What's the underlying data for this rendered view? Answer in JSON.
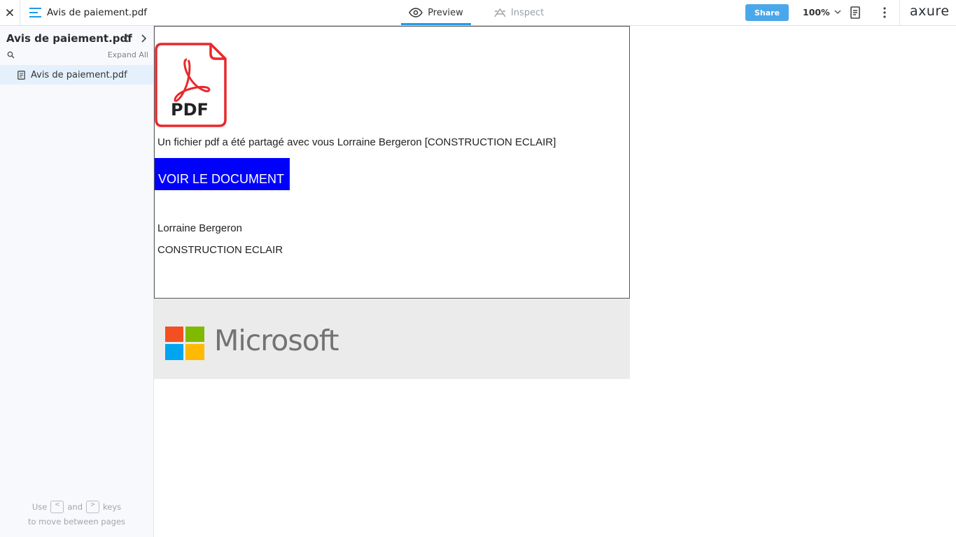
{
  "topbar": {
    "title": "Avis de paiement.pdf",
    "tabs": [
      {
        "label": "Preview",
        "active": true,
        "icon": "eye-icon"
      },
      {
        "label": "Inspect",
        "active": false,
        "icon": "inspect-icon"
      }
    ],
    "share_label": "Share",
    "zoom_label": "100%",
    "brand": "axure",
    "colors": {
      "accent": "#1f9ae8",
      "share": "#4aa8ea"
    }
  },
  "sidebar": {
    "title": "Avis de paiement.pdf",
    "expand_all": "Expand All",
    "pages": [
      {
        "label": "Avis de paiement.pdf",
        "selected": true
      }
    ],
    "hint": {
      "use": "Use",
      "prev_key": "<",
      "and": "and",
      "next_key": ">",
      "keys": "keys",
      "line2": "to move between pages"
    }
  },
  "content": {
    "pdf_icon_label": "PDF",
    "message": "Un fichier pdf a été partagé avec vous Lorraine Bergeron [CONSTRUCTION ECLAIR]",
    "cta_label": "VOIR LE DOCUMENT",
    "signature_name": "Lorraine Bergeron",
    "signature_company": "CONSTRUCTION ECLAIR",
    "banner_word": "Microsoft",
    "colors": {
      "cta": "#0000ff",
      "pdf_red": "#e8282b",
      "banner": "#ebebeb"
    }
  }
}
